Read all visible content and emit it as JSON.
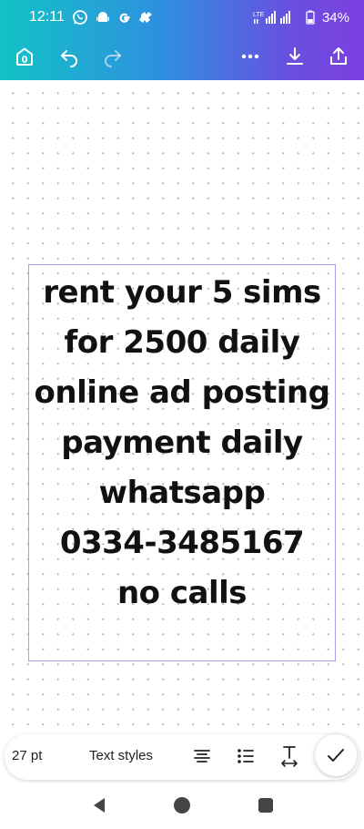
{
  "status_bar": {
    "time": "12:11",
    "network": "LTE",
    "battery": "34%",
    "icons": [
      "whatsapp-icon",
      "android-icon",
      "google-icon",
      "app-icon"
    ]
  },
  "toolbar": {
    "home_icon": "home-icon",
    "undo_icon": "undo-icon",
    "redo_icon": "redo-icon",
    "more_icon": "more-icon",
    "download_icon": "download-icon",
    "share_icon": "share-icon"
  },
  "canvas": {
    "lines": [
      "rent your 5 sims",
      "for 2500 daily",
      "online ad posting",
      "payment daily",
      "whatsapp",
      "0334-3485167",
      "no calls"
    ]
  },
  "text_toolbar": {
    "font_size": "27 pt",
    "text_styles": "Text styles"
  },
  "colors": {
    "header_start": "#12c3c6",
    "header_end": "#7d3fe0",
    "selection_border": "#a6a3f0"
  }
}
